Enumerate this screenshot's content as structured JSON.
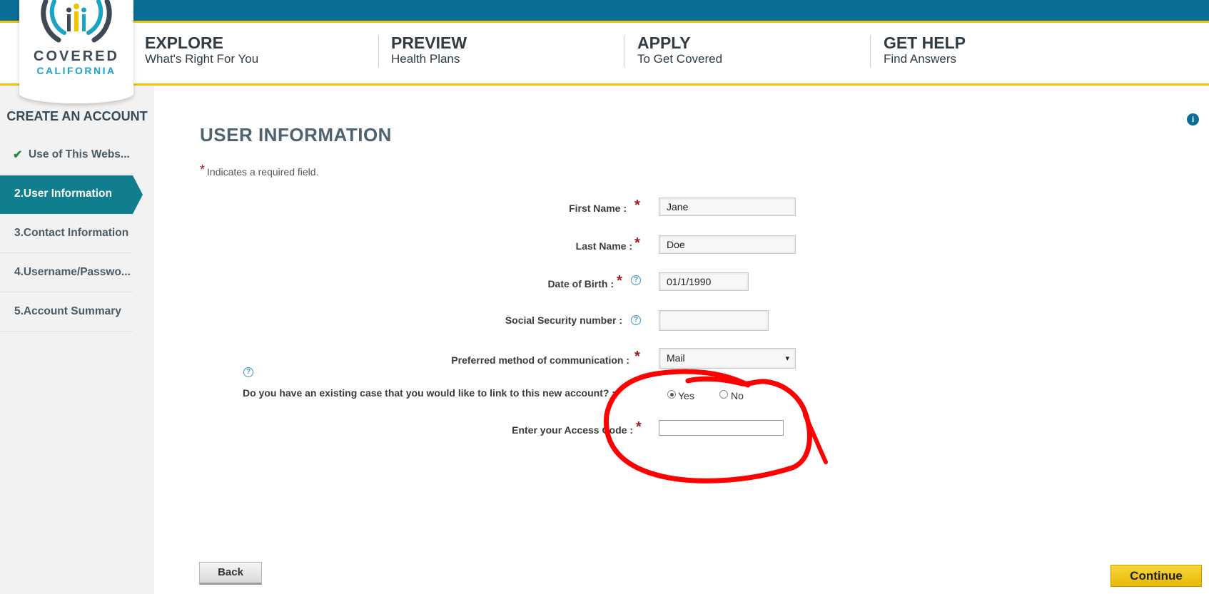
{
  "brand": {
    "name_line1": "COVERED",
    "name_line2": "CALIFORNIA",
    "primary_color": "#0a6e97",
    "accent_color": "#f2c400",
    "teal_color": "#107e8d"
  },
  "nav": [
    {
      "title": "EXPLORE",
      "subtitle": "What's Right For You"
    },
    {
      "title": "PREVIEW",
      "subtitle": "Health Plans"
    },
    {
      "title": "APPLY",
      "subtitle": "To Get Covered"
    },
    {
      "title": "GET HELP",
      "subtitle": "Find Answers"
    }
  ],
  "sidebar": {
    "title": "CREATE AN ACCOUNT",
    "items": [
      {
        "label": "Use of This Webs...",
        "state": "completed",
        "icon": "checkmark-icon"
      },
      {
        "label": "2.User Information",
        "state": "active"
      },
      {
        "label": "3.Contact Information",
        "state": "pending"
      },
      {
        "label": "4.Username/Passwo...",
        "state": "pending"
      },
      {
        "label": "5.Account Summary",
        "state": "pending"
      }
    ]
  },
  "main": {
    "title": "USER INFORMATION",
    "required_star": "*",
    "required_note": "Indicates a required field.",
    "fields": {
      "first_name": {
        "label": "First Name :",
        "value": "Jane",
        "required": true
      },
      "last_name": {
        "label": "Last Name :",
        "value": "Doe",
        "required": true
      },
      "dob": {
        "label": "Date of Birth :",
        "value": "01/1/1990",
        "required": true,
        "help": "?"
      },
      "ssn": {
        "label": "Social Security number :",
        "value": "",
        "required": false,
        "help": "?"
      },
      "communication": {
        "label": "Preferred method of communication :",
        "value": "Mail",
        "required": true,
        "caret": "▾"
      },
      "existing_case": {
        "label": "Do you have an existing case that you would like to link to this new account? :",
        "help": "?",
        "options": [
          "Yes",
          "No"
        ],
        "selected": "Yes"
      },
      "access_code": {
        "label": "Enter your Access Code :",
        "value": "",
        "required": true
      }
    }
  },
  "info_icon": "i",
  "buttons": {
    "back": "Back",
    "continue": "Continue"
  },
  "annotation": {
    "type": "hand-drawn circle",
    "color": "#ff0000",
    "target": "access-code-field"
  }
}
